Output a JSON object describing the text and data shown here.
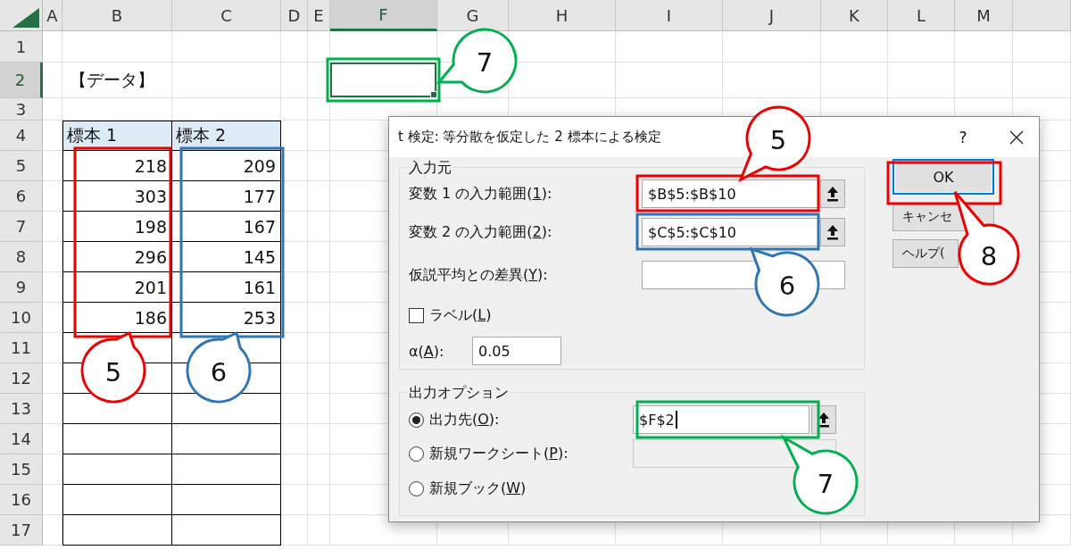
{
  "sheet": {
    "columns": [
      {
        "label": "A",
        "selected": false
      },
      {
        "label": "B",
        "selected": false
      },
      {
        "label": "C",
        "selected": false
      },
      {
        "label": "D",
        "selected": false
      },
      {
        "label": "E",
        "selected": false
      },
      {
        "label": "F",
        "selected": true
      },
      {
        "label": "G",
        "selected": false
      },
      {
        "label": "H",
        "selected": false
      },
      {
        "label": "I",
        "selected": false
      },
      {
        "label": "J",
        "selected": false
      },
      {
        "label": "K",
        "selected": false
      },
      {
        "label": "L",
        "selected": false
      },
      {
        "label": "M",
        "selected": false
      }
    ],
    "rows": [
      {
        "label": "1",
        "selected": false
      },
      {
        "label": "2",
        "selected": true
      },
      {
        "label": "3",
        "selected": false
      },
      {
        "label": "4",
        "selected": false
      },
      {
        "label": "5",
        "selected": false
      },
      {
        "label": "6",
        "selected": false
      },
      {
        "label": "7",
        "selected": false
      },
      {
        "label": "8",
        "selected": false
      },
      {
        "label": "9",
        "selected": false
      },
      {
        "label": "10",
        "selected": false
      },
      {
        "label": "11",
        "selected": false
      },
      {
        "label": "12",
        "selected": false
      },
      {
        "label": "13",
        "selected": false
      },
      {
        "label": "14",
        "selected": false
      },
      {
        "label": "15",
        "selected": false
      },
      {
        "label": "16",
        "selected": false
      },
      {
        "label": "17",
        "selected": false
      }
    ],
    "title": "【データ】",
    "table": {
      "columns": [
        "標本 1",
        "標本 2"
      ],
      "rows": [
        [
          "218",
          "209"
        ],
        [
          "303",
          "177"
        ],
        [
          "198",
          "167"
        ],
        [
          "296",
          "145"
        ],
        [
          "201",
          "161"
        ],
        [
          "186",
          "253"
        ]
      ]
    }
  },
  "dialog": {
    "title": "t 検定: 等分散を仮定した 2 標本による検定",
    "help": "?",
    "input_group": {
      "title": "入力元",
      "rows": [
        {
          "kind": "field",
          "label": "変数 1 の入力範囲(",
          "key": "1",
          "end": "):",
          "value": "$B$5:$B$10",
          "picker": true
        },
        {
          "kind": "field",
          "label": "変数 2 の入力範囲(",
          "key": "2",
          "end": "):",
          "value": "$C$5:$C$10",
          "picker": true
        },
        {
          "kind": "field",
          "label": "仮説平均との差異(",
          "key": "Y",
          "end": "):",
          "picker": false
        },
        {
          "kind": "checkbox",
          "label": "ラベル(",
          "key": "L",
          "end": ")",
          "checked": false
        },
        {
          "kind": "small_field",
          "label": "α(",
          "key": "A",
          "end": "):",
          "value": "0.05"
        }
      ]
    },
    "output_group": {
      "title": "出力オプション",
      "options": [
        {
          "label": "出力先(",
          "key": "O",
          "end": "):",
          "selected": true,
          "field": {
            "value": "$F$2",
            "disabled": false,
            "cursor": true
          }
        },
        {
          "label": "新規ワークシート(",
          "key": "P",
          "end": "):",
          "selected": false,
          "field": {
            "disabled": true
          }
        },
        {
          "label": "新規ブック(",
          "key": "W",
          "end": ")",
          "selected": false
        }
      ]
    },
    "buttons": [
      {
        "label": "OK",
        "focused": true
      },
      {
        "label": "キャンセ",
        "focused": false
      },
      {
        "label": "ヘルプ(",
        "focused": false
      }
    ]
  },
  "annotations": [
    {
      "number": "7",
      "color": "#00b050"
    },
    {
      "number": "5",
      "color": "#ee0000"
    },
    {
      "number": "8",
      "color": "#ee0000"
    },
    {
      "number": "6",
      "color": "#2e75b6"
    },
    {
      "number": "5",
      "color": "#ee0000"
    },
    {
      "number": "6",
      "color": "#2e75b6"
    },
    {
      "number": "7",
      "color": "#00b050"
    }
  ]
}
